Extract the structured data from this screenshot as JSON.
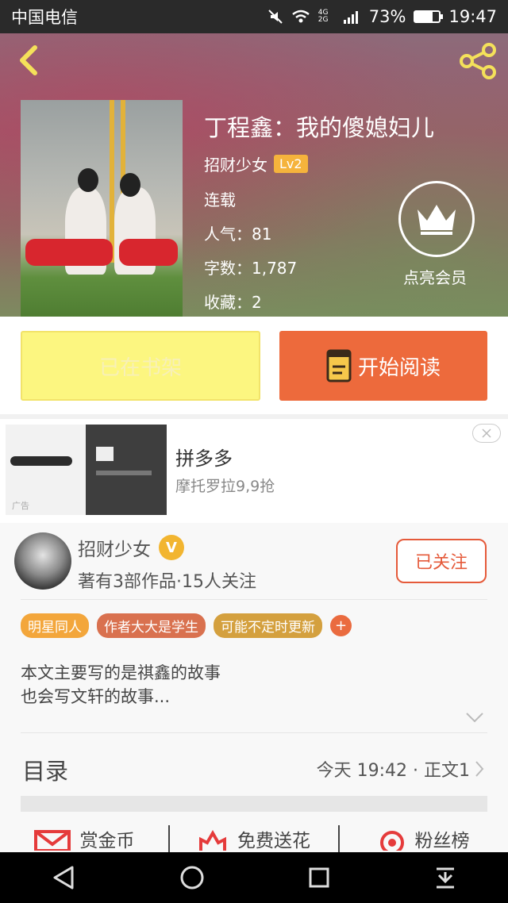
{
  "status_bar": {
    "carrier": "中国电信",
    "signal": "4G 2G",
    "battery": "73%",
    "battery_level": 0.73,
    "time": "19:47"
  },
  "book": {
    "title": "丁程鑫：我的傻媳妇儿",
    "author": "招财少女",
    "level": "Lv2",
    "status": "连载",
    "popularity": "人气：81",
    "word_count": "字数：1,787",
    "favorites": "收藏：2",
    "vip_label": "点亮会员"
  },
  "buttons": {
    "shelf": "已在书架",
    "read": "开始阅读"
  },
  "ad": {
    "title": "拼多多",
    "subtitle": "摩托罗拉9,9抢",
    "badge": "广告"
  },
  "author_card": {
    "name": "招财少女",
    "badge": "V",
    "stats": "著有3部作品·15人关注",
    "follow": "已关注"
  },
  "tags": [
    {
      "label": "明星同人",
      "color": "#f3a63b"
    },
    {
      "label": "作者大大是学生",
      "color": "#d9714f"
    },
    {
      "label": "可能不定时更新",
      "color": "#d4a03e"
    }
  ],
  "tag_plus": "+",
  "description": [
    "本文主要写的是祺鑫的故事",
    "也会写文轩的故事..."
  ],
  "toc": {
    "label": "目录",
    "latest": "今天 19:42 · 正文1"
  },
  "actions": [
    {
      "label": "赏金币",
      "icon": "envelope-icon"
    },
    {
      "label": "免费送花",
      "icon": "flower-icon"
    },
    {
      "label": "粉丝榜",
      "icon": "ranking-icon"
    }
  ],
  "colors": {
    "accent": "#ed6a3c",
    "shelf_bg": "#fcf680",
    "level_badge": "#f5b33c"
  }
}
